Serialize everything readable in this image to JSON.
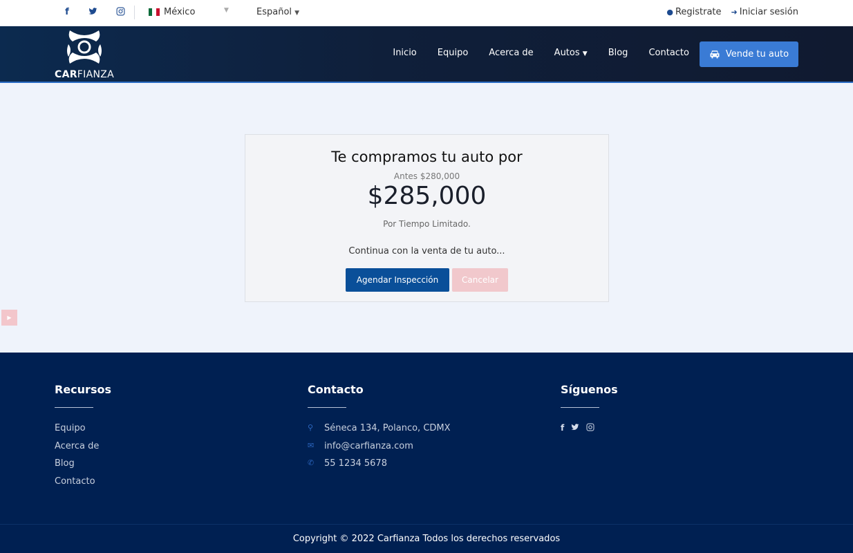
{
  "topbar": {
    "social_icons": [
      "facebook-icon",
      "twitter-icon",
      "instagram-icon"
    ],
    "country": "México",
    "language": "Español",
    "register": "Registrate",
    "login": "Iniciar sesión"
  },
  "nav": {
    "brand_bold": "CAR",
    "brand_rest": "FIANZA",
    "items": [
      "Inicio",
      "Equipo",
      "Acerca de",
      "Autos",
      "Blog",
      "Contacto"
    ],
    "sell_button": "Vende tu auto"
  },
  "offer": {
    "title": "Te compramos tu auto por",
    "before": "Antes $280,000",
    "price": "$285,000",
    "limited": "Por Tiempo Limitado.",
    "continue_text": "Continua con la venta de tu auto...",
    "schedule_button": "Agendar Inspección",
    "cancel_button": "Cancelar"
  },
  "footer": {
    "resources_title": "Recursos",
    "resources_links": [
      "Equipo",
      "Acerca de",
      "Blog",
      "Contacto"
    ],
    "contact_title": "Contacto",
    "address": "Séneca 134, Polanco, CDMX",
    "email": "info@carfianza.com",
    "phone": "55 1234 5678",
    "follow_title": "Síguenos",
    "copyright": "Copyright © 2022 Carfianza Todos los derechos reservados"
  },
  "colors": {
    "primary": "#0a4f99",
    "accent": "#3a7bd5",
    "footer_bg": "#002052",
    "cancel_bg": "#f1c8cc"
  }
}
